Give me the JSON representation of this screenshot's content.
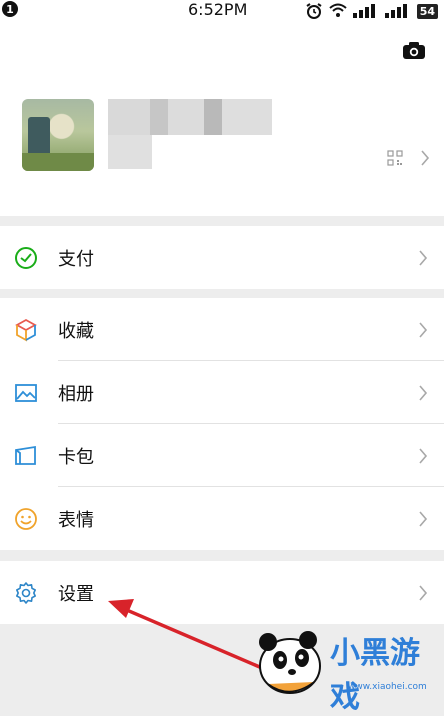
{
  "status_bar": {
    "notification_count": "1",
    "time": "6:52PM",
    "battery": "54",
    "icons": [
      "alarm-icon",
      "wifi-icon",
      "signal-icon",
      "signal-icon"
    ]
  },
  "profile": {
    "avatar": "avatar",
    "camera_icon": "camera-icon",
    "qr_icon": "qr-code-icon"
  },
  "menu": {
    "pay": "支付",
    "favorites": "收藏",
    "album": "相册",
    "cards": "卡包",
    "stickers": "表情",
    "settings": "设置"
  },
  "watermark": {
    "text": "小黑游戏",
    "url": "www.xiaohei.com"
  },
  "colors": {
    "pay_green": "#1aad19",
    "album_blue": "#2e8fd8",
    "settings_blue": "#2e86c8",
    "stickers_orange": "#f0a32b",
    "arrow_red": "#d8232a"
  }
}
